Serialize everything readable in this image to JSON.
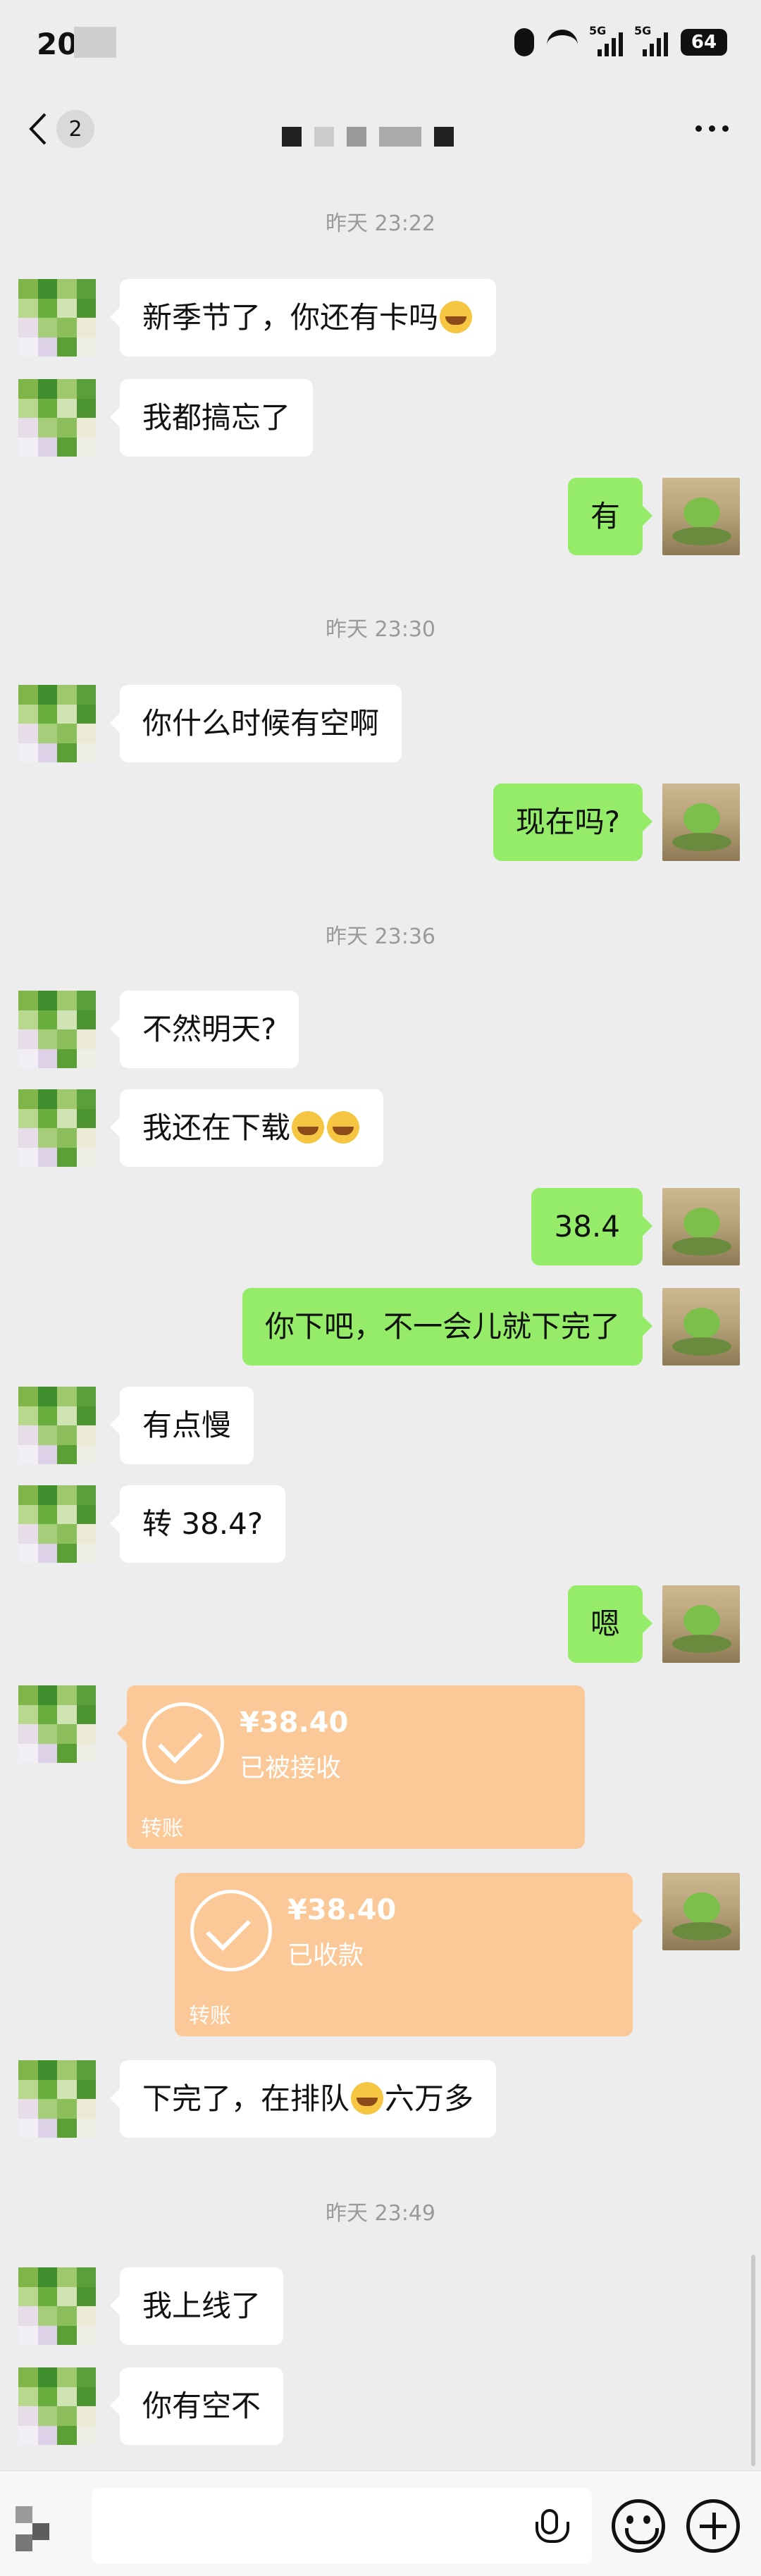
{
  "status_bar": {
    "time": "20",
    "battery": "64",
    "signal_label": "5G"
  },
  "nav": {
    "unread_count": "2"
  },
  "timestamps": [
    "昨天 23:22",
    "昨天 23:30",
    "昨天 23:36",
    "昨天 23:49"
  ],
  "messages": {
    "m1": {
      "text": "新季节了，你还有卡吗"
    },
    "m2": {
      "text": "我都搞忘了"
    },
    "m3": {
      "text": "有"
    },
    "m4": {
      "text": "你什么时候有空啊"
    },
    "m5": {
      "text": "现在吗?"
    },
    "m6": {
      "text": "不然明天?"
    },
    "m7": {
      "text": "我还在下载"
    },
    "m8": {
      "text": "38.4"
    },
    "m9": {
      "text": "你下吧，不一会儿就下完了"
    },
    "m10": {
      "text": "有点慢"
    },
    "m11": {
      "text": "转 38.4?"
    },
    "m12": {
      "text": "嗯"
    },
    "m13": {
      "text_before": "下完了，在排队",
      "text_after": "六万多"
    },
    "m14": {
      "text": "我上线了"
    },
    "m15": {
      "text": "你有空不"
    }
  },
  "transfers": {
    "t1": {
      "amount": "¥38.40",
      "status": "已被接收",
      "label": "转账"
    },
    "t2": {
      "amount": "¥38.40",
      "status": "已收款",
      "label": "转账"
    }
  },
  "colors": {
    "background": "#ededed",
    "bubble_self": "#95ec69",
    "bubble_other": "#ffffff",
    "transfer": "#fbc998"
  },
  "icons": [
    "back-chevron-icon",
    "more-dots-icon",
    "voice-icon",
    "emoji-icon",
    "plus-icon",
    "check-icon"
  ]
}
